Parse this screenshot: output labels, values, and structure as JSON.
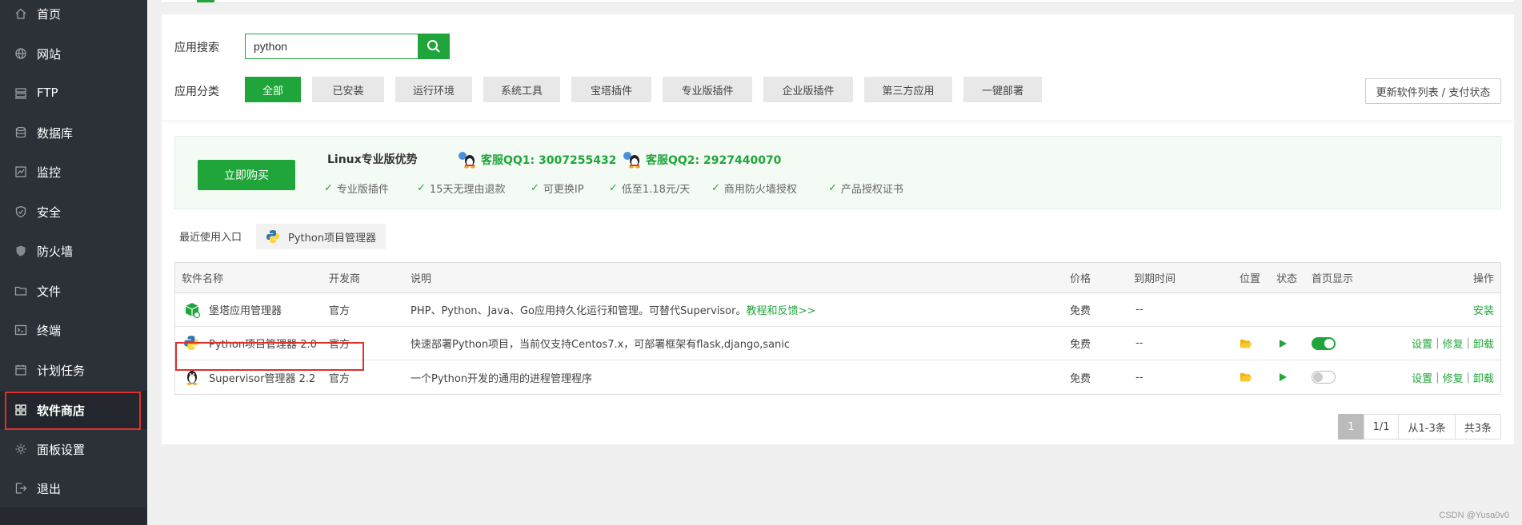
{
  "sidebar": {
    "items": [
      {
        "label": "首页",
        "icon": "home-icon"
      },
      {
        "label": "网站",
        "icon": "globe-icon"
      },
      {
        "label": "FTP",
        "icon": "ftp-icon"
      },
      {
        "label": "数据库",
        "icon": "database-icon"
      },
      {
        "label": "监控",
        "icon": "monitor-icon"
      },
      {
        "label": "安全",
        "icon": "shield-check-icon"
      },
      {
        "label": "防火墙",
        "icon": "firewall-shield-icon"
      },
      {
        "label": "文件",
        "icon": "folder-icon"
      },
      {
        "label": "终端",
        "icon": "terminal-icon"
      },
      {
        "label": "计划任务",
        "icon": "calendar-icon"
      },
      {
        "label": "软件商店",
        "icon": "grid-apps-icon",
        "active": true
      },
      {
        "label": "面板设置",
        "icon": "gear-icon"
      },
      {
        "label": "退出",
        "icon": "logout-icon"
      }
    ]
  },
  "search": {
    "label": "应用搜索",
    "value": "python"
  },
  "categories": {
    "label": "应用分类",
    "items": [
      "全部",
      "已安装",
      "运行环境",
      "系统工具",
      "宝塔插件",
      "专业版插件",
      "企业版插件",
      "第三方应用",
      "一键部署"
    ],
    "active": "全部"
  },
  "update_button": "更新软件列表 / 支付状态",
  "promo": {
    "buy_button": "立即购买",
    "title": "Linux专业版优势",
    "qq1": "客服QQ1: 3007255432",
    "qq2": "客服QQ2: 2927440070",
    "features": [
      "专业版插件",
      "15天无理由退款",
      "可更换IP",
      "低至1.18元/天",
      "商用防火墙授权",
      "产品授权证书"
    ]
  },
  "recent": {
    "label": "最近使用入口",
    "item": "Python项目管理器"
  },
  "table": {
    "headers": [
      "软件名称",
      "开发商",
      "说明",
      "价格",
      "到期时间",
      "位置",
      "状态",
      "首页显示",
      "操作"
    ],
    "rows": [
      {
        "name": "堡塔应用管理器",
        "developer": "官方",
        "description": "PHP、Python、Java、Go应用持久化运行和管理。可替代Supervisor。",
        "description_link": "教程和反馈>>",
        "price": "免费",
        "expire": "--",
        "ops": [
          "安装"
        ]
      },
      {
        "name": "Python项目管理器 2.0",
        "developer": "官方",
        "description": "快速部署Python项目，当前仅支持Centos7.x，可部署框架有flask,django,sanic",
        "price": "免费",
        "expire": "--",
        "homepage_display": true,
        "ops": [
          "设置",
          "修复",
          "卸载"
        ]
      },
      {
        "name": "Supervisor管理器 2.2",
        "developer": "官方",
        "description": "一个Python开发的通用的进程管理程序",
        "price": "免费",
        "expire": "--",
        "homepage_display": false,
        "ops": [
          "设置",
          "修复",
          "卸载"
        ]
      }
    ]
  },
  "pagination": {
    "current": "1",
    "pages": "1/1",
    "range": "从1-3条",
    "total": "共3条"
  },
  "watermark": "CSDN @Yusa0v0",
  "colors": {
    "accent": "#20a53a",
    "sidebar_bg": "#2c3138",
    "highlight_red": "#e0302d"
  }
}
